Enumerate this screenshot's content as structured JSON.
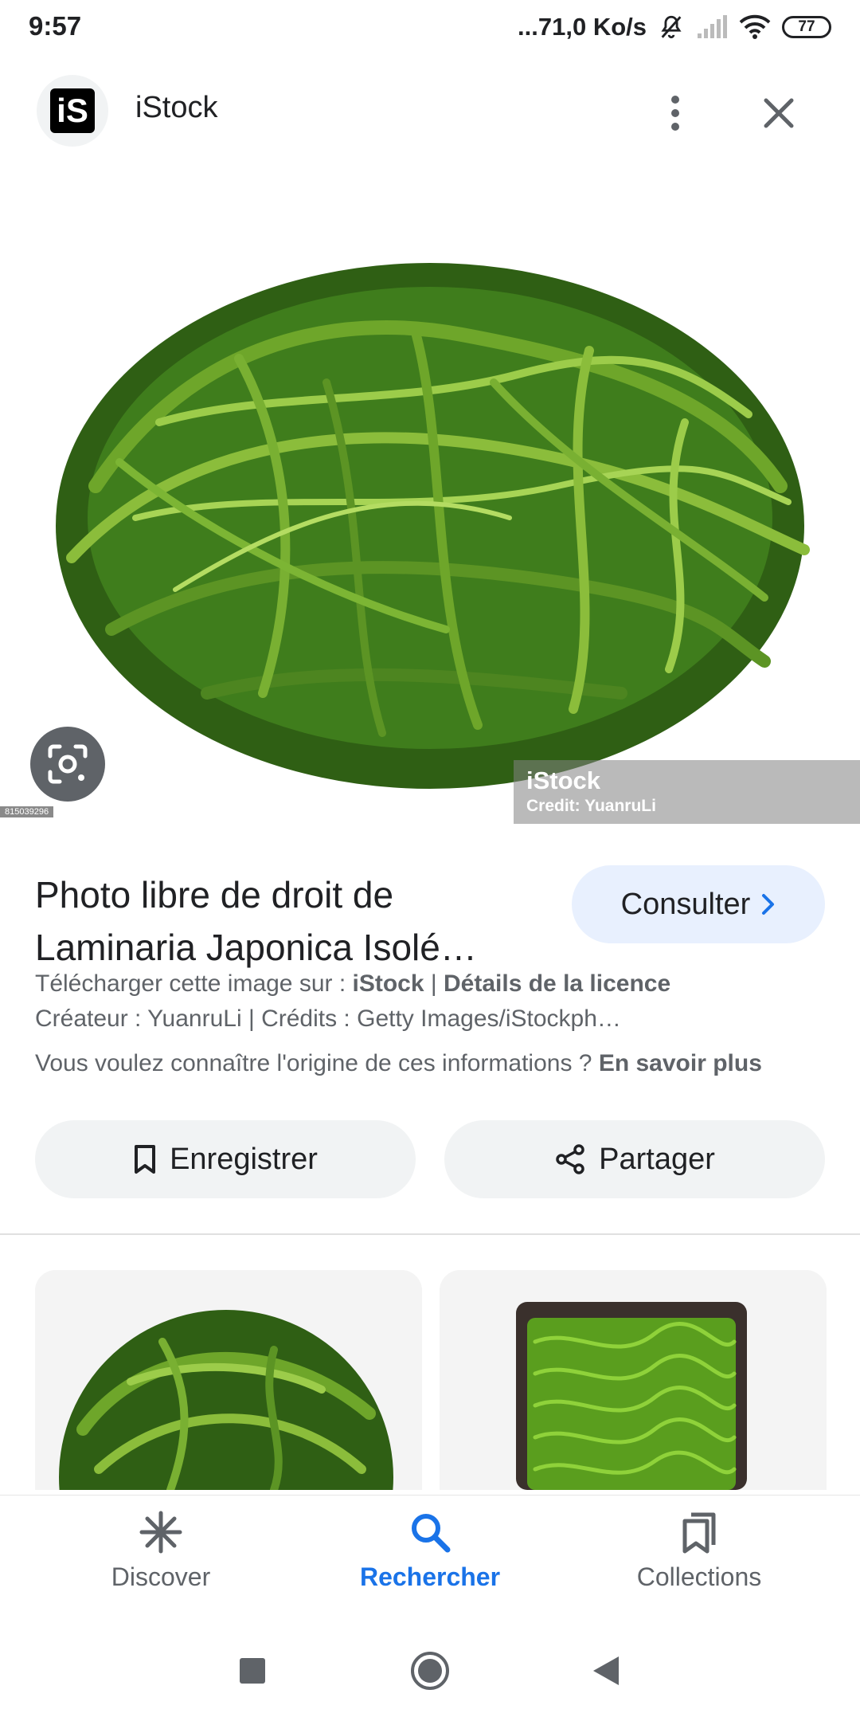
{
  "status_bar": {
    "time": "9:57",
    "speed": "...71,0 Ko/s",
    "battery": "77"
  },
  "header": {
    "logo_text": "iS",
    "site_name": "iStock"
  },
  "image": {
    "watermark_title": "iStock",
    "watermark_credit": "Credit: YuanruLi",
    "image_id": "815039296"
  },
  "info": {
    "title": "Photo libre de droit de Laminaria Japonica Isolé…",
    "consult_label": "Consulter",
    "download_prefix": "Télécharger cette image sur : ",
    "download_site": "iStock",
    "separator": " | ",
    "license_link": "Détails de la licence",
    "creator_line": "Créateur : YuanruLi | Crédits : Getty Images/iStockph…",
    "origin_question": "Vous voulez connaître l'origine de ces informations ? ",
    "learn_more": "En savoir plus"
  },
  "actions": {
    "save_label": "Enregistrer",
    "share_label": "Partager"
  },
  "bottom_nav": {
    "items": [
      {
        "label": "Discover",
        "icon": "asterisk-icon"
      },
      {
        "label": "Rechercher",
        "icon": "search-icon",
        "active": true
      },
      {
        "label": "Collections",
        "icon": "collections-icon"
      }
    ]
  },
  "colors": {
    "accent": "#1a73e8",
    "consult_bg": "#e8f0fe",
    "pill_bg": "#f1f3f4",
    "seaweed": "#3f7d1c"
  }
}
